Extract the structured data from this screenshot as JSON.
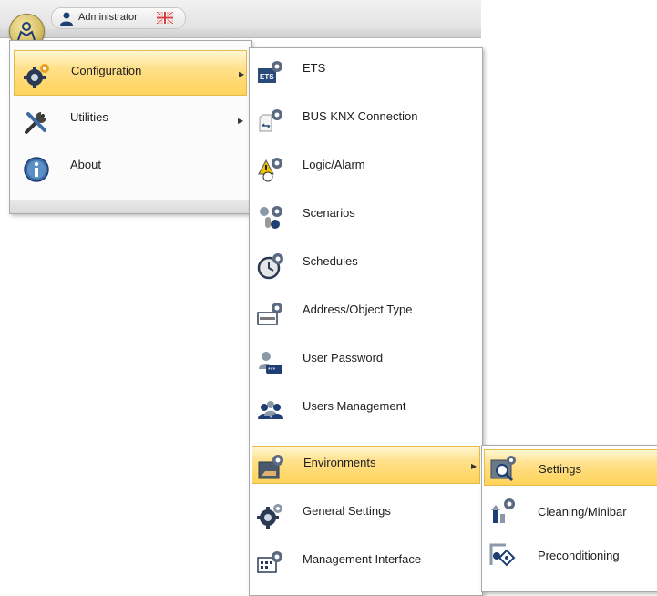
{
  "header": {
    "user_name": "Administrator",
    "user_icon": "user-icon",
    "flag_icon": "uk-flag-icon",
    "app_button_icon": "app-logo-icon"
  },
  "main_menu": {
    "items": [
      {
        "label": "Configuration",
        "icon": "gear-icon",
        "has_submenu": true,
        "highlighted": true
      },
      {
        "label": "Utilities",
        "icon": "tools-icon",
        "has_submenu": true,
        "highlighted": false
      },
      {
        "label": "About",
        "icon": "info-icon",
        "has_submenu": false,
        "highlighted": false
      }
    ]
  },
  "configuration_menu": {
    "items": [
      {
        "label": "ETS",
        "icon": "ets-icon"
      },
      {
        "label": "BUS KNX Connection",
        "icon": "bus-connection-icon"
      },
      {
        "label": "Logic/Alarm",
        "icon": "logic-alarm-icon"
      },
      {
        "label": "Scenarios",
        "icon": "scenarios-icon"
      },
      {
        "label": "Schedules",
        "icon": "schedules-icon"
      },
      {
        "label": "Address/Object Type",
        "icon": "address-type-icon"
      },
      {
        "label": "User Password",
        "icon": "user-password-icon"
      },
      {
        "label": "Users Management",
        "icon": "users-management-icon"
      },
      {
        "label": "Environments",
        "icon": "environments-icon",
        "has_submenu": true,
        "highlighted": true
      },
      {
        "label": "General Settings",
        "icon": "general-settings-icon"
      },
      {
        "label": "Management Interface",
        "icon": "management-interface-icon"
      }
    ]
  },
  "environments_menu": {
    "items": [
      {
        "label": "Settings",
        "icon": "environment-settings-icon",
        "highlighted": true
      },
      {
        "label": "Cleaning/Minibar",
        "icon": "cleaning-minibar-icon"
      },
      {
        "label": "Preconditioning",
        "icon": "preconditioning-icon"
      }
    ]
  },
  "colors": {
    "highlight_top": "#fff8d4",
    "highlight_bottom": "#ffd35a",
    "gear_blue": "#2a4a7a",
    "gear_orange": "#e8a020"
  }
}
